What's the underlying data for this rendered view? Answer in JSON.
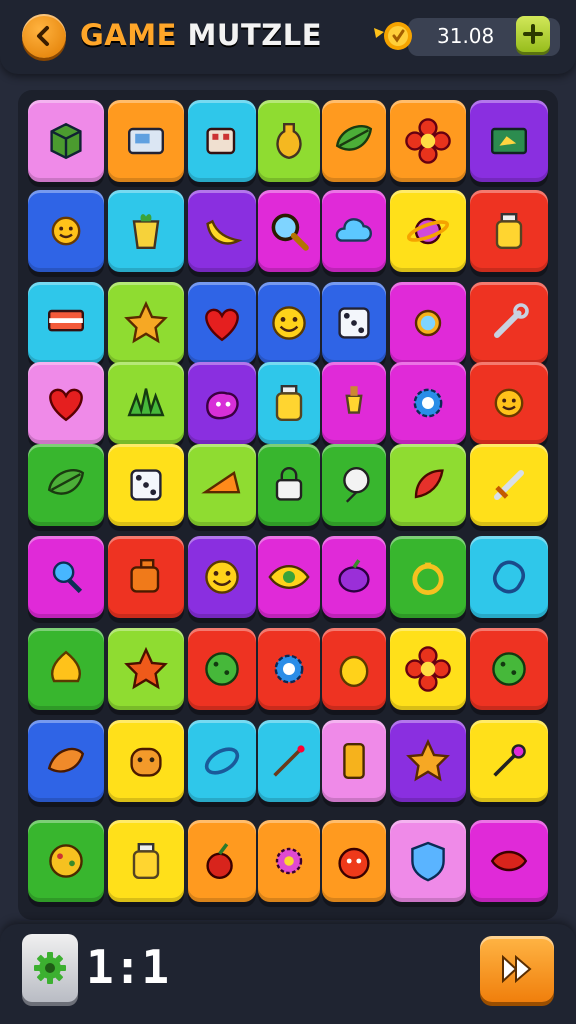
{
  "header": {
    "title_word1": "GAME",
    "title_word2": "MUTZLE",
    "balance": "31.08"
  },
  "footer": {
    "level": "1:1"
  },
  "colors": {
    "orange": "#ff9a1f",
    "green": "#38b62e",
    "lime": "#8fdc31",
    "yellow": "#ffe01a",
    "blue": "#2f64e6",
    "cyan": "#2fc7ea",
    "purple": "#8a2fe0",
    "magenta": "#e02ad8",
    "pink": "#ef8ae8",
    "red": "#ee3322"
  },
  "board": {
    "columns": 8,
    "rows": 8,
    "tiles": [
      {
        "color": "pink",
        "icon": "cube-icon"
      },
      {
        "color": "orange",
        "icon": "console-icon"
      },
      {
        "color": "cyan",
        "icon": "robot-icon"
      },
      {
        "color": "lime",
        "icon": "potion-icon"
      },
      {
        "color": "orange",
        "icon": "leaf-icon"
      },
      {
        "color": "orange",
        "icon": "flower-icon"
      },
      {
        "color": "purple",
        "icon": "picture-icon"
      },
      {
        "color": "blue",
        "icon": "sun-icon"
      },
      {
        "color": "cyan",
        "icon": "cup-icon"
      },
      {
        "color": "purple",
        "icon": "banana-icon"
      },
      {
        "color": "magenta",
        "icon": "magnifier-icon"
      },
      {
        "color": "magenta",
        "icon": "cloud-icon"
      },
      {
        "color": "yellow",
        "icon": "planet-icon"
      },
      {
        "color": "red",
        "icon": "bottle-icon"
      },
      {
        "color": "cyan",
        "icon": "flag-icon"
      },
      {
        "color": "lime",
        "icon": "star-badge-icon"
      },
      {
        "color": "blue",
        "icon": "heart-icon"
      },
      {
        "color": "blue",
        "icon": "smiley-icon"
      },
      {
        "color": "blue",
        "icon": "dice-icon"
      },
      {
        "color": "magenta",
        "icon": "crab-icon"
      },
      {
        "color": "red",
        "icon": "wrench-icon"
      },
      {
        "color": "pink",
        "icon": "heart-icon"
      },
      {
        "color": "lime",
        "icon": "grass-icon"
      },
      {
        "color": "purple",
        "icon": "blob-icon"
      },
      {
        "color": "cyan",
        "icon": "bottle-icon"
      },
      {
        "color": "magenta",
        "icon": "lamp-icon"
      },
      {
        "color": "magenta",
        "icon": "gear-icon"
      },
      {
        "color": "red",
        "icon": "sun-icon"
      },
      {
        "color": "green",
        "icon": "leaf-icon"
      },
      {
        "color": "yellow",
        "icon": "dice-icon"
      },
      {
        "color": "lime",
        "icon": "cheese-icon"
      },
      {
        "color": "green",
        "icon": "lock-icon"
      },
      {
        "color": "green",
        "icon": "balloon-icon"
      },
      {
        "color": "lime",
        "icon": "feather-icon"
      },
      {
        "color": "yellow",
        "icon": "sword-icon"
      },
      {
        "color": "magenta",
        "icon": "key-icon"
      },
      {
        "color": "red",
        "icon": "bag-icon"
      },
      {
        "color": "purple",
        "icon": "smiley-icon"
      },
      {
        "color": "magenta",
        "icon": "eye-icon"
      },
      {
        "color": "magenta",
        "icon": "plum-icon"
      },
      {
        "color": "green",
        "icon": "ring-icon"
      },
      {
        "color": "cyan",
        "icon": "clip-icon"
      },
      {
        "color": "green",
        "icon": "onion-icon"
      },
      {
        "color": "lime",
        "icon": "star-icon"
      },
      {
        "color": "red",
        "icon": "ball-icon"
      },
      {
        "color": "red",
        "icon": "gear-icon"
      },
      {
        "color": "red",
        "icon": "lemon-icon"
      },
      {
        "color": "yellow",
        "icon": "flower-icon"
      },
      {
        "color": "red",
        "icon": "ball-icon"
      },
      {
        "color": "blue",
        "icon": "shell-icon"
      },
      {
        "color": "yellow",
        "icon": "face-icon"
      },
      {
        "color": "cyan",
        "icon": "seed-icon"
      },
      {
        "color": "cyan",
        "icon": "pin-icon"
      },
      {
        "color": "pink",
        "icon": "phone-icon"
      },
      {
        "color": "purple",
        "icon": "star-badge-icon"
      },
      {
        "color": "yellow",
        "icon": "brush-icon"
      },
      {
        "color": "green",
        "icon": "cookie-icon"
      },
      {
        "color": "yellow",
        "icon": "bottle-icon"
      },
      {
        "color": "orange",
        "icon": "cherry-icon"
      },
      {
        "color": "orange",
        "icon": "virus-icon"
      },
      {
        "color": "orange",
        "icon": "monster-icon"
      },
      {
        "color": "pink",
        "icon": "shield-icon"
      },
      {
        "color": "magenta",
        "icon": "lips-icon"
      }
    ]
  }
}
